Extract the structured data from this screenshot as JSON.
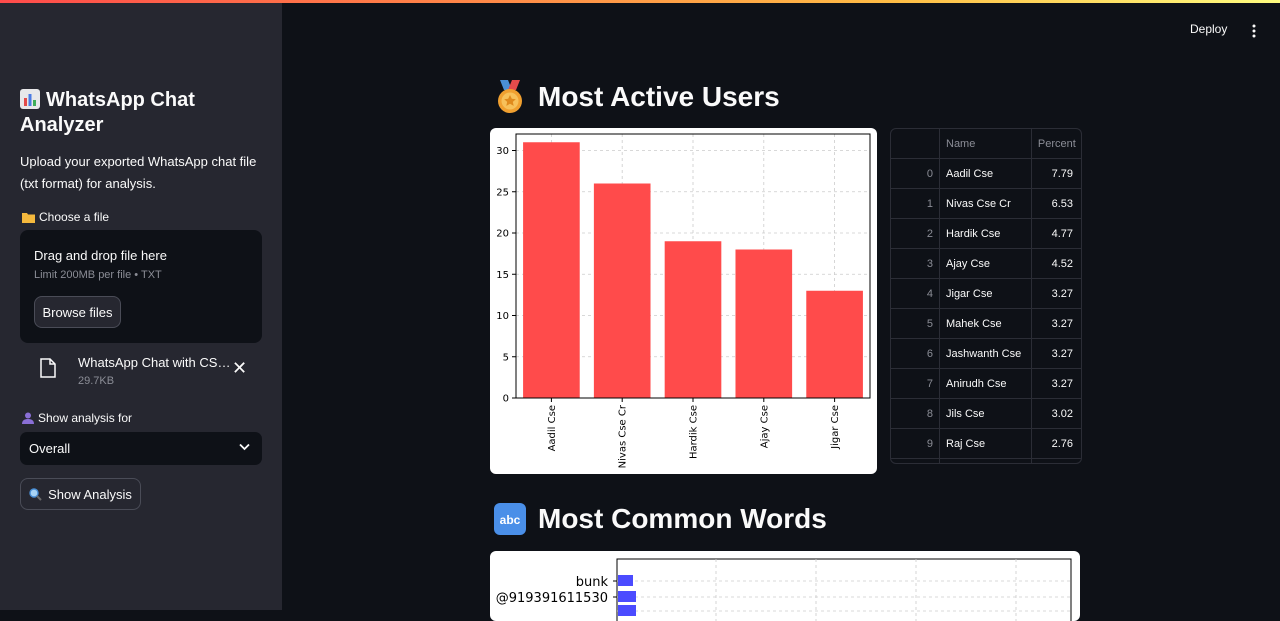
{
  "sidebar": {
    "title": "WhatsApp Chat Analyzer",
    "description": "Upload your exported WhatsApp chat file (txt format) for analysis.",
    "file_label": "Choose a file",
    "dropzone_title": "Drag and drop file here",
    "dropzone_limit": "Limit 200MB per file • TXT",
    "browse_label": "Browse files",
    "uploaded_file_name": "WhatsApp Chat with CSE ...",
    "uploaded_file_size": "29.7KB",
    "select_label": "Show analysis for",
    "select_value": "Overall",
    "show_button_label": "Show Analysis"
  },
  "header": {
    "deploy_label": "Deploy"
  },
  "sections": {
    "active_users_title": "Most Active Users",
    "common_words_title": "Most Common Words"
  },
  "table": {
    "headers": [
      "",
      "Name",
      "Percent"
    ],
    "rows": [
      {
        "index": "0",
        "name": "Aadil Cse",
        "percent": "7.79"
      },
      {
        "index": "1",
        "name": "Nivas Cse Cr",
        "percent": "6.53"
      },
      {
        "index": "2",
        "name": "Hardik Cse",
        "percent": "4.77"
      },
      {
        "index": "3",
        "name": "Ajay Cse",
        "percent": "4.52"
      },
      {
        "index": "4",
        "name": "Jigar Cse",
        "percent": "3.27"
      },
      {
        "index": "5",
        "name": "Mahek Cse",
        "percent": "3.27"
      },
      {
        "index": "6",
        "name": "Jashwanth Cse",
        "percent": "3.27"
      },
      {
        "index": "7",
        "name": "Anirudh Cse",
        "percent": "3.27"
      },
      {
        "index": "8",
        "name": "Jils Cse",
        "percent": "3.02"
      },
      {
        "index": "9",
        "name": "Raj Cse",
        "percent": "2.76"
      }
    ]
  },
  "chart_data": [
    {
      "type": "bar",
      "categories": [
        "Aadil Cse",
        "Nivas Cse Cr",
        "Hardik Cse",
        "Ajay Cse",
        "Jigar Cse"
      ],
      "values": [
        31,
        26,
        19,
        18,
        13
      ],
      "ylim": [
        0,
        32
      ],
      "yticks": [
        0,
        5,
        10,
        15,
        20,
        25,
        30
      ],
      "grid": true,
      "bar_color": "#ff4b4b"
    },
    {
      "type": "bar",
      "orientation": "horizontal",
      "categories": [
        "bunk",
        "@919391611530"
      ],
      "grid": true,
      "bar_color": "#4b4bff"
    }
  ],
  "colors": {
    "accent": "#ff4b4b",
    "background": "#0e1117",
    "sidebar": "#262730"
  }
}
